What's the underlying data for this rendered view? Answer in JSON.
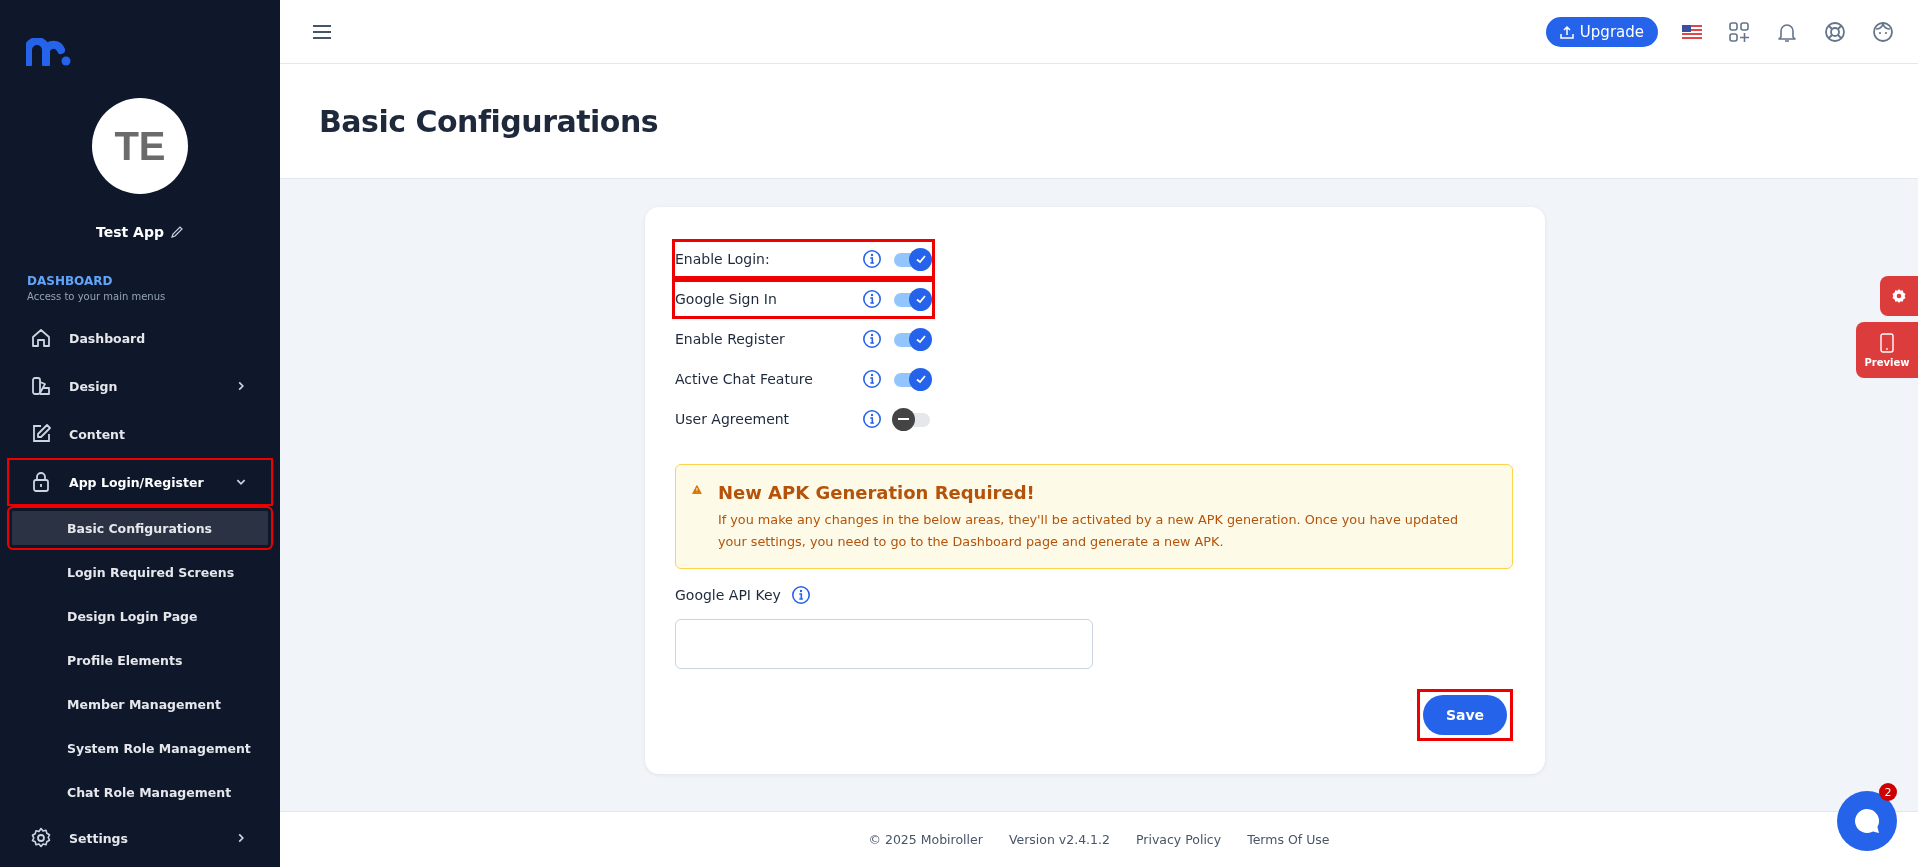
{
  "sidebar": {
    "app_initials": "TE",
    "app_name": "Test App",
    "section_title": "DASHBOARD",
    "section_subtitle": "Access to your main menus",
    "items": [
      {
        "label": "Dashboard",
        "highlighted": false
      },
      {
        "label": "Design",
        "expanded": false,
        "highlighted": false
      },
      {
        "label": "Content",
        "highlighted": false
      },
      {
        "label": "App Login/Register",
        "expanded": true,
        "highlighted": true,
        "children": [
          {
            "label": "Basic Configurations",
            "selected": true,
            "highlighted": true
          },
          {
            "label": "Login Required Screens",
            "selected": false,
            "highlighted": false
          },
          {
            "label": "Design Login Page",
            "selected": false,
            "highlighted": false
          },
          {
            "label": "Profile Elements",
            "selected": false,
            "highlighted": false
          },
          {
            "label": "Member Management",
            "selected": false,
            "highlighted": false
          },
          {
            "label": "System Role Management",
            "selected": false,
            "highlighted": false
          },
          {
            "label": "Chat Role Management",
            "selected": false,
            "highlighted": false
          }
        ]
      },
      {
        "label": "Settings",
        "expanded": false,
        "highlighted": false
      }
    ]
  },
  "topbar": {
    "upgrade_button": "Upgrade"
  },
  "page_title": "Basic Configurations",
  "settings": [
    {
      "label": "Enable Login:",
      "on": true,
      "highlighted": true
    },
    {
      "label": "Google Sign In",
      "on": true,
      "highlighted": true
    },
    {
      "label": "Enable Register",
      "on": true,
      "highlighted": false
    },
    {
      "label": "Active Chat Feature",
      "on": true,
      "highlighted": false
    },
    {
      "label": "User Agreement",
      "on": false,
      "highlighted": false
    }
  ],
  "alert": {
    "title": "New APK Generation Required!",
    "message": "If you make any changes in the below areas, they'll be activated by a new APK generation. Once you have updated your settings, you need to go to the Dashboard page and generate a new APK."
  },
  "api_key": {
    "label": "Google API Key"
  },
  "save_button": {
    "label": "Save",
    "highlighted": true
  },
  "side_tabs": {
    "preview": "Preview"
  },
  "footer": {
    "copyright": "© 2025 Mobiroller",
    "version": "Version v2.4.1.2",
    "links": [
      "Privacy Policy",
      "Terms Of Use"
    ]
  },
  "chat": {
    "badge": "2"
  }
}
